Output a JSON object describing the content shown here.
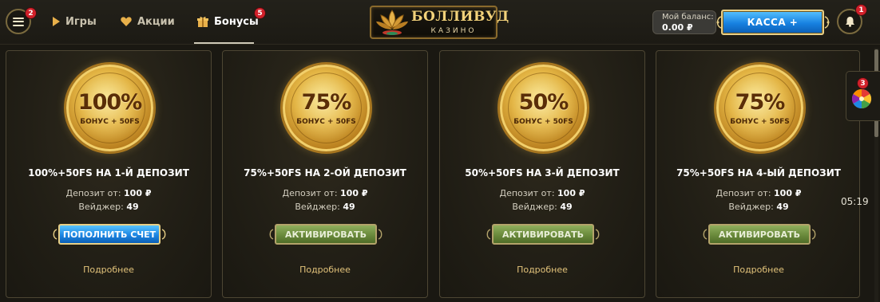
{
  "header": {
    "menu_badge": "2",
    "nav": [
      {
        "label": "Игры",
        "icon": "play-icon"
      },
      {
        "label": "Акции",
        "icon": "heart-icon"
      },
      {
        "label": "Бонусы",
        "icon": "gift-icon",
        "badge": "5",
        "active": true
      }
    ],
    "logo": {
      "title": "БОЛЛИВУД",
      "subtitle": "КАЗИНО"
    },
    "balance": {
      "label": "Мой баланс:",
      "value": "0.00 ₽"
    },
    "cashier_label": "КАССА +",
    "notifications_badge": "1"
  },
  "cards": [
    {
      "coin_percent": "100%",
      "coin_sub": "БОНУС + 50FS",
      "title": "100%+50FS НА 1-Й ДЕПОЗИТ",
      "deposit_label": "Депозит от:",
      "deposit_value": "100 ₽",
      "wager_label": "Вейджер:",
      "wager_value": "49",
      "button_label": "ПОПОЛНИТЬ СЧЕТ",
      "button_style": "blue",
      "more_label": "Подробнее"
    },
    {
      "coin_percent": "75%",
      "coin_sub": "БОНУС + 50FS",
      "title": "75%+50FS НА 2-ОЙ ДЕПОЗИТ",
      "deposit_label": "Депозит от:",
      "deposit_value": "100 ₽",
      "wager_label": "Вейджер:",
      "wager_value": "49",
      "button_label": "АКТИВИРОВАТЬ",
      "button_style": "green",
      "more_label": "Подробнее"
    },
    {
      "coin_percent": "50%",
      "coin_sub": "БОНУС + 50FS",
      "title": "50%+50FS НА 3-Й ДЕПОЗИТ",
      "deposit_label": "Депозит от:",
      "deposit_value": "100 ₽",
      "wager_label": "Вейджер:",
      "wager_value": "49",
      "button_label": "АКТИВИРОВАТЬ",
      "button_style": "green",
      "more_label": "Подробнее"
    },
    {
      "coin_percent": "75%",
      "coin_sub": "БОНУС + 50FS",
      "title": "75%+50FS НА 4-ЫЙ ДЕПОЗИТ",
      "deposit_label": "Депозит от:",
      "deposit_value": "100 ₽",
      "wager_label": "Вейджер:",
      "wager_value": "49",
      "button_label": "АКТИВИРОВАТЬ",
      "button_style": "green",
      "more_label": "Подробнее"
    }
  ],
  "side": {
    "wheel_badge": "3",
    "timer": "05:19"
  },
  "colors": {
    "accent_gold": "#e1c27a",
    "button_blue": "#1d86e3",
    "button_green": "#6a8a3c",
    "badge_red": "#d1202a"
  }
}
